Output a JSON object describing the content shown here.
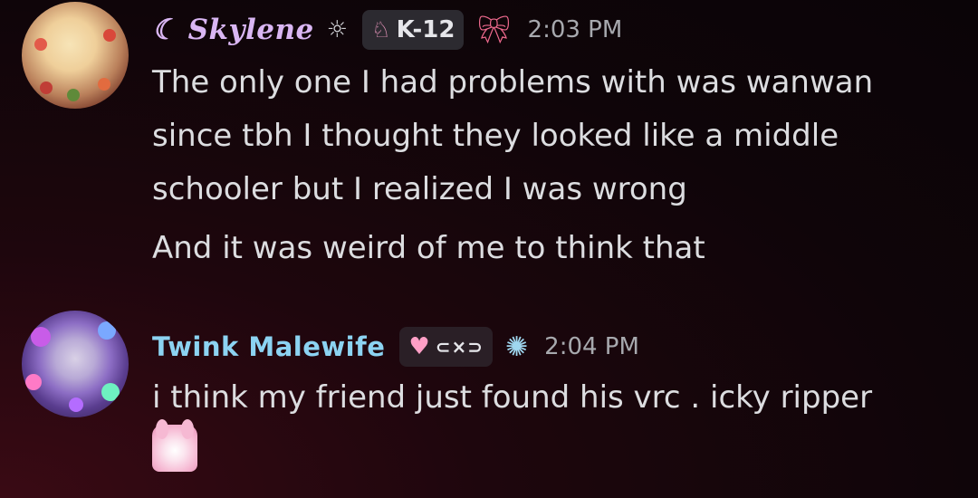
{
  "messages": [
    {
      "username": "☾ Skylene",
      "status_icon": "sun-icon",
      "tag_icon": "bunny-icon",
      "tag_text": "K-12",
      "decoration": "ribbon-bow-icon",
      "timestamp": "2:03 PM",
      "lines": [
        "The only one I had problems with was wanwan since tbh I thought they looked like a middle schooler but I realized I was wrong",
        "And it was weird of me to think that"
      ]
    },
    {
      "username": "Twink Malewife",
      "tag_icon": "heart-icon",
      "tag_text": "⊂×⊃",
      "decoration": "sparkle-globe-icon",
      "timestamp": "2:04 PM",
      "lines": [
        "i think my friend just found his vrc . icky ripper"
      ],
      "sticker": "my-melody-sticker"
    }
  ],
  "colors": {
    "username1": "#d9b6f3",
    "username2": "#8cd3f2",
    "text": "#dcdde0",
    "timestamp": "#a7a9ae",
    "tag_bg": "#2c2a30"
  }
}
